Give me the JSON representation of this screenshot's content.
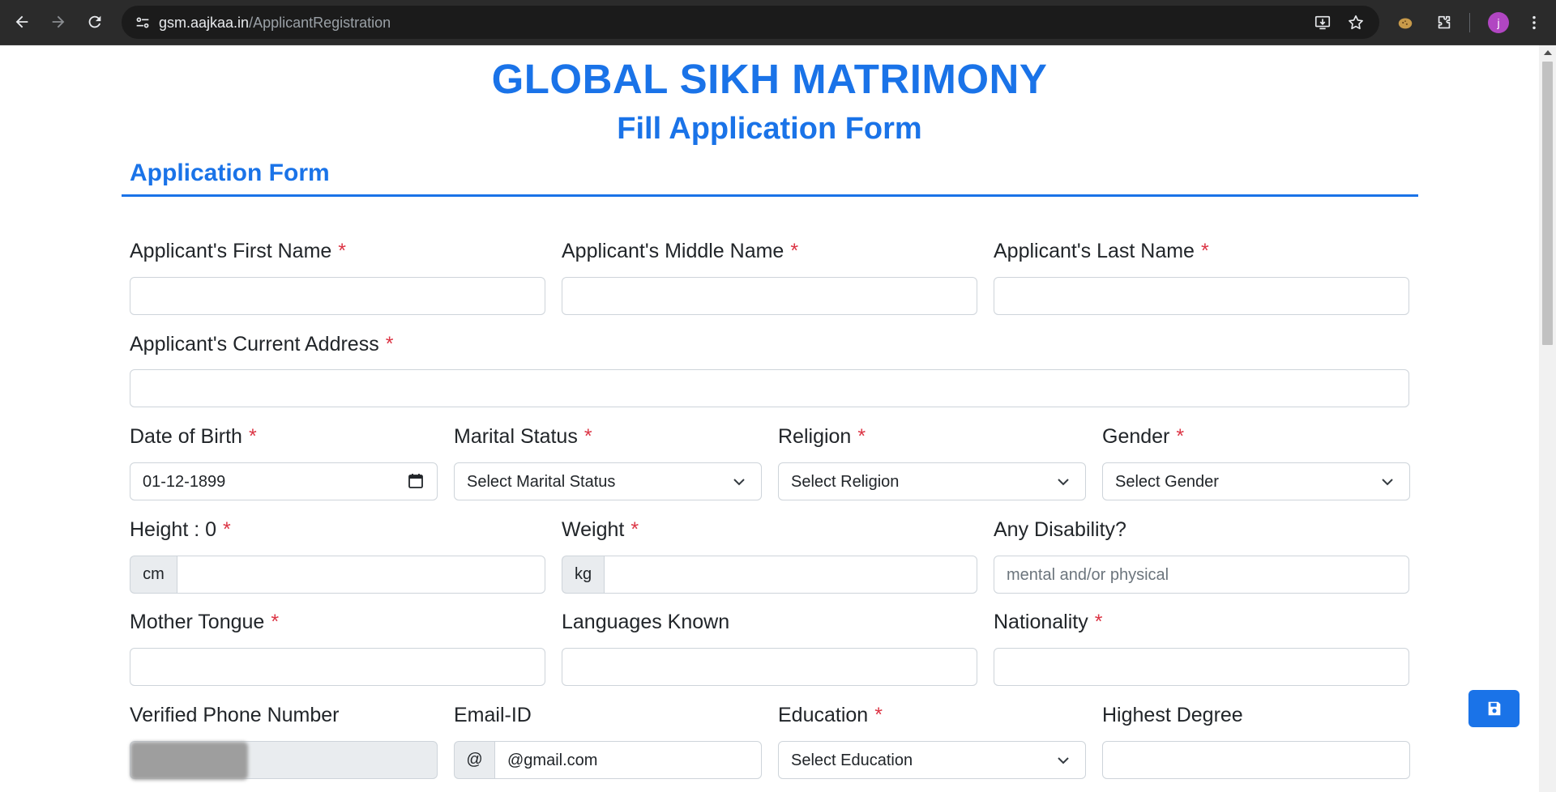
{
  "browser": {
    "url_host": "gsm.aajkaa.in",
    "url_path": "/ApplicantRegistration",
    "avatar_letter": "j",
    "accent": "#1a73e8"
  },
  "header": {
    "title": "GLOBAL SIKH MATRIMONY",
    "subtitle": "Fill Application Form",
    "section": "Application Form"
  },
  "form": {
    "first_name": {
      "label": "Applicant's First Name",
      "required": "*",
      "value": ""
    },
    "middle_name": {
      "label": "Applicant's Middle Name",
      "required": "*",
      "value": ""
    },
    "last_name": {
      "label": "Applicant's Last Name",
      "required": "*",
      "value": ""
    },
    "address": {
      "label": "Applicant's Current Address",
      "required": "*",
      "value": ""
    },
    "dob": {
      "label": "Date of Birth",
      "required": "*",
      "value": "01-12-1899"
    },
    "marital_status": {
      "label": "Marital Status",
      "required": "*",
      "value": "Select Marital Status"
    },
    "religion": {
      "label": "Religion",
      "required": "*",
      "value": "Select Religion"
    },
    "gender": {
      "label": "Gender",
      "required": "*",
      "value": "Select Gender"
    },
    "height": {
      "label": "Height : 0",
      "required": "*",
      "addon": "cm",
      "value": ""
    },
    "weight": {
      "label": "Weight",
      "required": "*",
      "addon": "kg",
      "value": ""
    },
    "disability": {
      "label": "Any Disability?",
      "placeholder": "mental and/or physical"
    },
    "mother_tongue": {
      "label": "Mother Tongue",
      "required": "*",
      "value": ""
    },
    "languages": {
      "label": "Languages Known",
      "value": ""
    },
    "nationality": {
      "label": "Nationality",
      "required": "*",
      "value": ""
    },
    "phone": {
      "label": "Verified Phone Number",
      "value": ""
    },
    "email": {
      "label": "Email-ID",
      "addon": "@",
      "value": "@gmail.com"
    },
    "education": {
      "label": "Education",
      "required": "*",
      "value": "Select Education"
    },
    "highest_degree": {
      "label": "Highest Degree",
      "value": ""
    }
  }
}
